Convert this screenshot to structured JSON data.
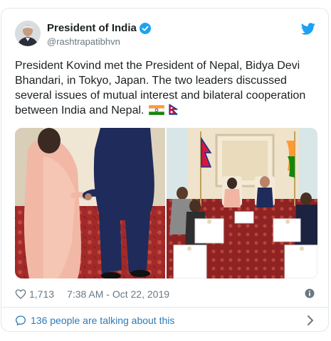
{
  "tweet": {
    "author_name": "President of India",
    "author_handle": "@rashtrapatibhvn",
    "text": "President Kovind met the President of Nepal, Bidya Devi Bhandari, in Tokyo, Japan. The two leaders discussed several issues of mutual interest and bilateral cooperation between India and Nepal.",
    "likes": "1,713",
    "timestamp": "7:38 AM - Oct 22, 2019"
  },
  "conversation": {
    "label": "136 people are talking about this"
  },
  "icons": {
    "verified": "verified-badge-icon",
    "platform": "twitter-bird-icon",
    "like": "heart-icon",
    "info": "info-icon",
    "comment": "speech-bubble-icon",
    "chevron": "chevron-right-icon"
  },
  "colors": {
    "brand_blue": "#1da1f2",
    "link_blue": "#2b7bb9",
    "text": "#1c2022",
    "muted": "#697882",
    "border": "#e1e8ed"
  }
}
